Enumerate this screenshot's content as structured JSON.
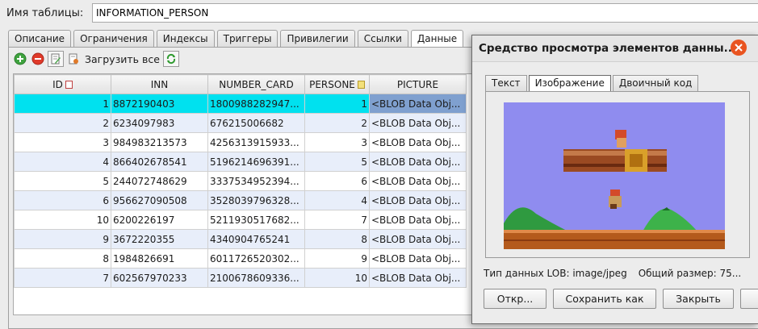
{
  "header": {
    "table_name_label": "Имя таблицы:",
    "table_name_value": "INFORMATION_PERSON"
  },
  "tabs": [
    "Описание",
    "Ограничения",
    "Индексы",
    "Триггеры",
    "Привилегии",
    "Ссылки",
    "Данные"
  ],
  "active_tab_index": 6,
  "toolbar": {
    "load_all_label": "Загрузить все"
  },
  "grid": {
    "columns": [
      "ID",
      "INN",
      "NUMBER_CARD",
      "PERSONE",
      "PICTURE"
    ],
    "selected_row": 0,
    "rows": [
      [
        "1",
        "8872190403",
        "1800988282947...",
        "1",
        "<BLOB Data Obj..."
      ],
      [
        "2",
        "6234097983",
        "676215006682",
        "2",
        "<BLOB Data Obj..."
      ],
      [
        "3",
        "984983213573",
        "4256313915933...",
        "3",
        "<BLOB Data Obj..."
      ],
      [
        "4",
        "866402678541",
        "5196214696391...",
        "5",
        "<BLOB Data Obj..."
      ],
      [
        "5",
        "244072748629",
        "3337534952394...",
        "6",
        "<BLOB Data Obj..."
      ],
      [
        "6",
        "956627090508",
        "3528039796328...",
        "4",
        "<BLOB Data Obj..."
      ],
      [
        "10",
        "6200226197",
        "5211930517682...",
        "7",
        "<BLOB Data Obj..."
      ],
      [
        "9",
        "3672220355",
        "4340904765241",
        "8",
        "<BLOB Data Obj..."
      ],
      [
        "8",
        "1984826691",
        "6011726520302...",
        "9",
        "<BLOB Data Obj..."
      ],
      [
        "7",
        "602567970233",
        "2100678609336...",
        "10",
        "<BLOB Data Obj..."
      ]
    ]
  },
  "viewer": {
    "title": "Средство просмотра элементов данны...",
    "tabs": [
      "Текст",
      "Изображение",
      "Двоичный код"
    ],
    "active_tab_index": 1,
    "lob_type": "Тип данных LOB: image/jpeg",
    "total_size": "Общий размер: 75...",
    "buttons": {
      "open": "Откр...",
      "save_as": "Сохранить как",
      "close": "Закрыть"
    }
  },
  "colors": {
    "selection": "#00e1ef",
    "selected_cell": "#7fa0cf",
    "close_button": "#e95420",
    "image_sky": "#8f8cef"
  }
}
